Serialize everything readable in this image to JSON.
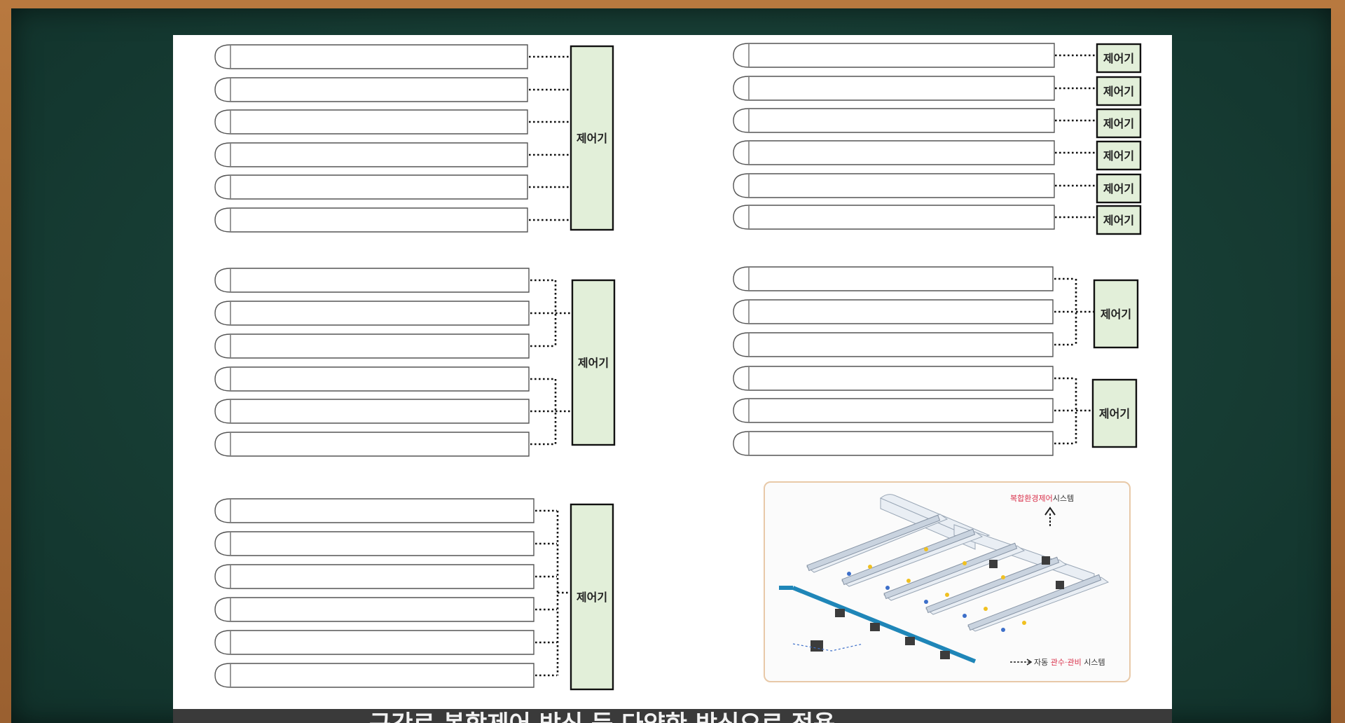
{
  "controller_label": "제어기",
  "photo": {
    "top_label_prefix": "복합환경제어",
    "top_label_suffix": "시스템",
    "bottom_label_prefix": "자동 ",
    "bottom_label_highlight": "관수·관비",
    "bottom_label_suffix": " 시스템"
  },
  "caption": "구간로 복합제어 방식 등 다양한 방식으로 적용"
}
